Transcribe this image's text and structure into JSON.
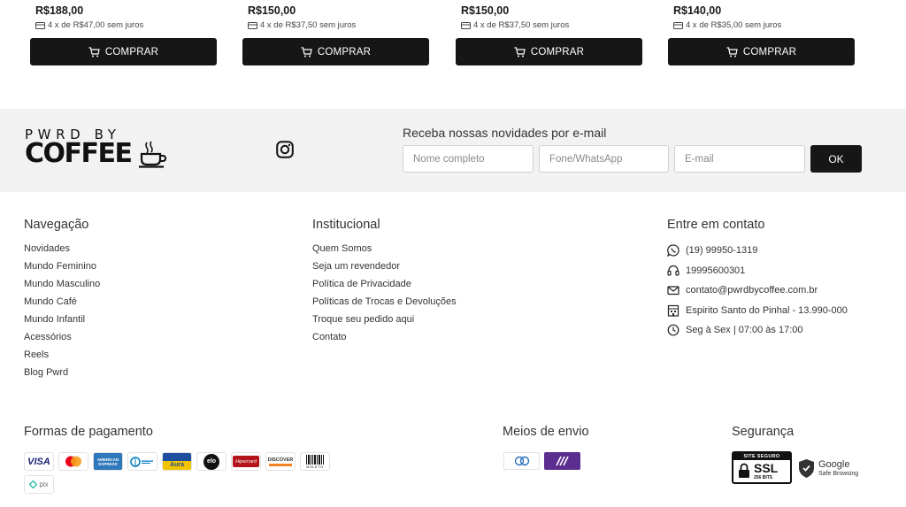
{
  "products": [
    {
      "price": "R$188,00",
      "installments": "4 x de R$47,00 sem juros",
      "button": "COMPRAR"
    },
    {
      "price": "R$150,00",
      "installments": "4 x de R$37,50 sem juros",
      "button": "COMPRAR"
    },
    {
      "price": "R$150,00",
      "installments": "4 x de R$37,50 sem juros",
      "button": "COMPRAR"
    },
    {
      "price": "R$140,00",
      "installments": "4 x de R$35,00 sem juros",
      "button": "COMPRAR"
    }
  ],
  "brand": {
    "logo_top": "PWRD BY",
    "logo_main": "COFFEE"
  },
  "newsletter": {
    "title": "Receba nossas novidades por e-mail",
    "name_placeholder": "Nome completo",
    "phone_placeholder": "Fone/WhatsApp",
    "email_placeholder": "E-mail",
    "submit": "OK"
  },
  "navigation": {
    "title": "Navegação",
    "items": [
      "Novidades",
      "Mundo Feminino",
      "Mundo Masculino",
      "Mundo Café",
      "Mundo Infantil",
      "Acessórios",
      "Reels",
      "Blog Pwrd"
    ]
  },
  "institutional": {
    "title": "Institucional",
    "items": [
      "Quem Somos",
      "Seja um revendedor",
      "Política de Privacidade",
      "Políticas de Trocas e Devoluções",
      "Troque seu pedido aqui",
      "Contato"
    ]
  },
  "contact": {
    "title": "Entre em contato",
    "whatsapp": "(19) 99950-1319",
    "phone": "19995600301",
    "email": "contato@pwrdbycoffee.com.br",
    "address": "Espirito Santo do Pinhal - 13.990-000",
    "hours": "Seg à Sex | 07:00 às 17:00"
  },
  "payment": {
    "title": "Formas de pagamento",
    "visa": "VISA",
    "amex": "AMERICAN EXPRESS",
    "aura": "Aura",
    "elo": "elo",
    "hipercard": "Hipercard",
    "discover": "DISCOVER",
    "boleto": "BOLETO",
    "pix": "pix"
  },
  "shipping": {
    "title": "Meios de envio"
  },
  "security": {
    "title": "Segurança",
    "ssl_top": "SITE SEGURO",
    "ssl_main": "SSL",
    "ssl_bits": "256 BITS",
    "google": "Google",
    "google_sub": "Safe Browsing"
  },
  "colors": {
    "primary": "#161616",
    "band": "#f2f2f2",
    "text": "#333333"
  }
}
